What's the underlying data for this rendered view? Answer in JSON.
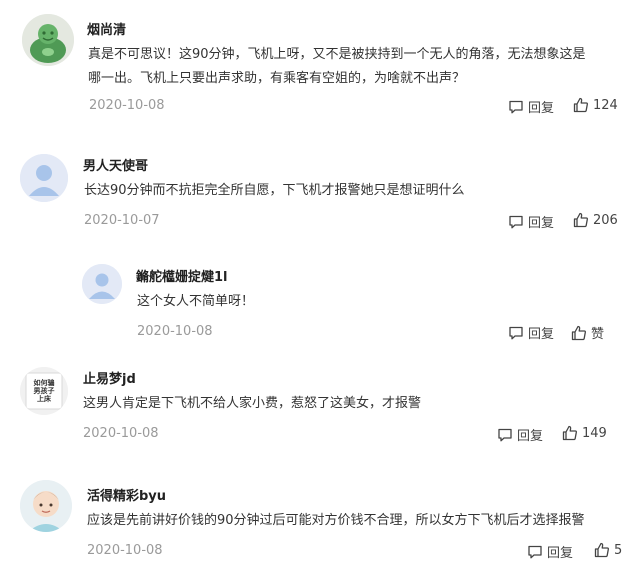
{
  "comments": [
    {
      "username": "烟尚清",
      "avatar_icon": "jade-buddha-avatar",
      "lines": [
        "真是不可思议！这90分钟，飞机上呀，又不是被挟持到一个无人的角落，无法想象这是",
        "哪一出。飞机上只要出声求助，有乘客有空姐的，为啥就不出声？"
      ],
      "date": "2020-10-08",
      "reply_label": "回复",
      "likes": "124"
    },
    {
      "username": "男人天使哥",
      "avatar_icon": "default-user-avatar",
      "lines": [
        "长达90分钟而不抗拒完全所自愿，下飞机才报警她只是想证明什么"
      ],
      "date": "2020-10-07",
      "reply_label": "回复",
      "likes": "206"
    },
    {
      "username": "鏅舵櫙姗掟煡1l",
      "avatar_icon": "default-user-avatar",
      "lines": [
        "这个女人不简单呀！"
      ],
      "date": "2020-10-08",
      "reply_label": "回复",
      "likes": "赞"
    },
    {
      "username": "止易梦jd",
      "avatar_icon": "text-sticker-avatar",
      "avatar_text": [
        "如何骗",
        "男孩子",
        "上床"
      ],
      "lines": [
        "这男人肯定是下飞机不给人家小费，惹怒了这美女，才报警"
      ],
      "date": "2020-10-08",
      "reply_label": "回复",
      "likes": "149"
    },
    {
      "username": "活得精彩byu",
      "avatar_icon": "baby-photo-avatar",
      "lines": [
        "应该是先前讲好价钱的90分钟过后可能对方价钱不合理，所以女方下飞机后才选择报警"
      ],
      "date": "2020-10-08",
      "reply_label": "回复",
      "likes": "5"
    }
  ],
  "colors": {
    "text": "#333333",
    "date": "#9a9a9a",
    "accent_avatar": "#a8c4ea"
  }
}
